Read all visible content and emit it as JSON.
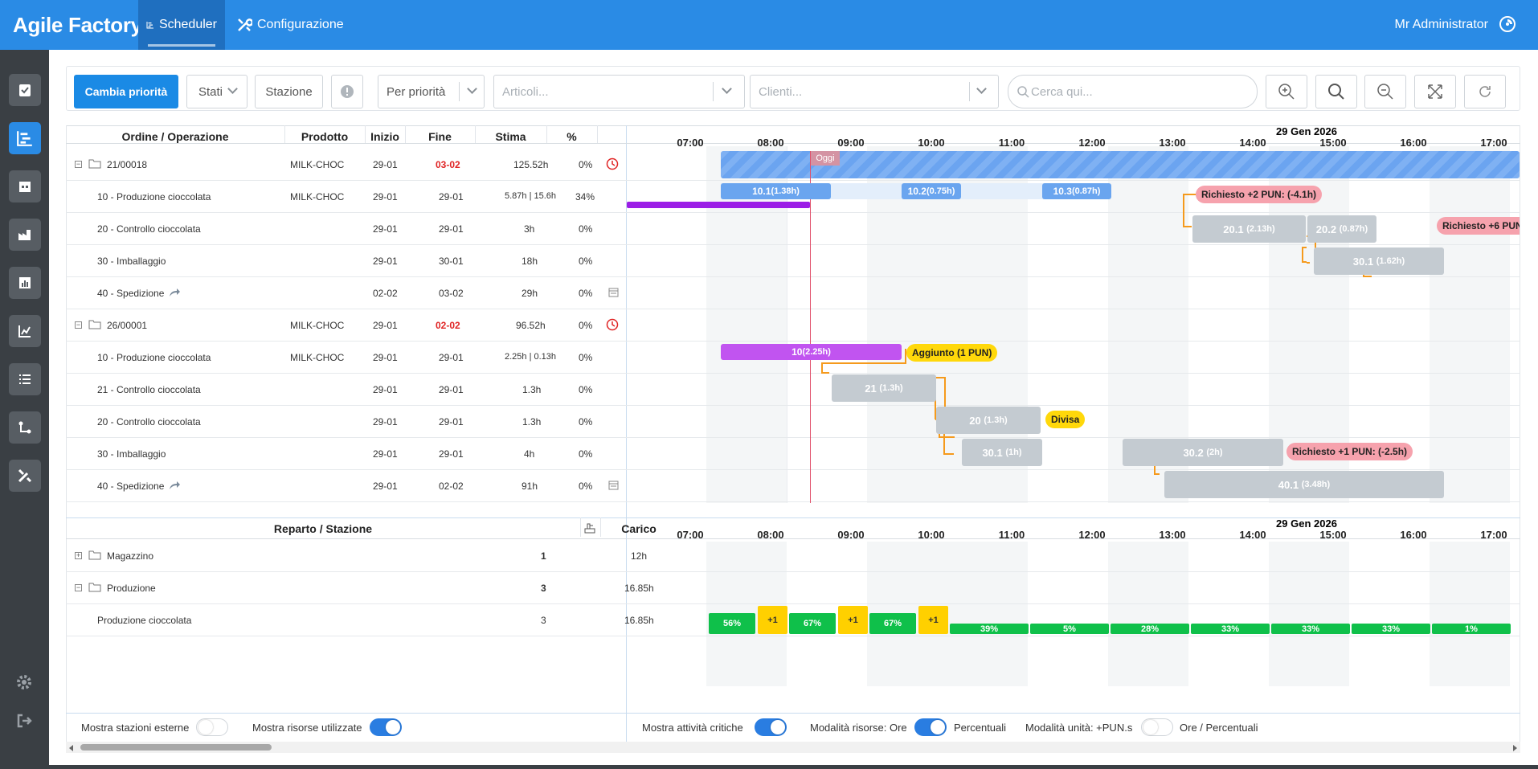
{
  "app": {
    "title": "Agile Factory",
    "user": "Mr Administrator"
  },
  "nav": {
    "scheduler": "Scheduler",
    "config": "Configurazione"
  },
  "toolbar": {
    "cambia_priorita": "Cambia priorità",
    "stati": "Stati",
    "stazione": "Stazione",
    "sort": "Per priorità",
    "articoli_ph": "Articoli...",
    "clienti_ph": "Clienti...",
    "search_ph": "Cerca qui..."
  },
  "orders_table": {
    "headers": {
      "ordine": "Ordine / Operazione",
      "prodotto": "Prodotto",
      "inizio": "Inizio",
      "fine": "Fine",
      "stima": "Stima",
      "pct": "%"
    },
    "rows": [
      {
        "name": "21/00018",
        "prodotto": "MILK-CHOC",
        "inizio": "29-01",
        "fine": "03-02",
        "stima": "125.52h",
        "pct": "0%"
      },
      {
        "name": "10 - Produzione cioccolata",
        "prodotto": "MILK-CHOC",
        "inizio": "29-01",
        "fine": "29-01",
        "stima": "5.87h | 15.6h",
        "pct": "34%"
      },
      {
        "name": "20 - Controllo cioccolata",
        "prodotto": "",
        "inizio": "29-01",
        "fine": "29-01",
        "stima": "3h",
        "pct": "0%"
      },
      {
        "name": "30 - Imballaggio",
        "prodotto": "",
        "inizio": "29-01",
        "fine": "30-01",
        "stima": "18h",
        "pct": "0%"
      },
      {
        "name": "40 - Spedizione",
        "prodotto": "",
        "inizio": "02-02",
        "fine": "03-02",
        "stima": "29h",
        "pct": "0%"
      },
      {
        "name": "26/00001",
        "prodotto": "MILK-CHOC",
        "inizio": "29-01",
        "fine": "02-02",
        "stima": "96.52h",
        "pct": "0%"
      },
      {
        "name": "10 - Produzione cioccolata",
        "prodotto": "MILK-CHOC",
        "inizio": "29-01",
        "fine": "29-01",
        "stima": "2.25h | 0.13h",
        "pct": "0%"
      },
      {
        "name": "21 - Controllo cioccolata",
        "prodotto": "",
        "inizio": "29-01",
        "fine": "29-01",
        "stima": "1.3h",
        "pct": "0%"
      },
      {
        "name": "20 - Controllo cioccolata",
        "prodotto": "",
        "inizio": "29-01",
        "fine": "29-01",
        "stima": "1.3h",
        "pct": "0%"
      },
      {
        "name": "30 - Imballaggio",
        "prodotto": "",
        "inizio": "29-01",
        "fine": "29-01",
        "stima": "4h",
        "pct": "0%"
      },
      {
        "name": "40 - Spedizione",
        "prodotto": "",
        "inizio": "29-01",
        "fine": "02-02",
        "stima": "91h",
        "pct": "0%"
      }
    ]
  },
  "timeline": {
    "date": "29 Gen 2026",
    "hours": [
      "07:00",
      "08:00",
      "09:00",
      "10:00",
      "11:00",
      "12:00",
      "13:00",
      "14:00",
      "15:00",
      "16:00",
      "17:00"
    ],
    "today": "Oggi"
  },
  "gantt": {
    "bar_101": "10.1",
    "bar_101_d": "(1.38h)",
    "bar_102": "10.2",
    "bar_102_d": "(0.75h)",
    "bar_103": "10.3",
    "bar_103_d": "(0.87h)",
    "tag_req2": "Richiesto +2 PUN: (-4.1h)",
    "bar_201": "20.1",
    "bar_201_d": "(2.13h)",
    "bar_202": "20.2",
    "bar_202_d": "(0.87h)",
    "tag_req6": "Richiesto +6 PUN",
    "bar_301a": "30.1",
    "bar_301a_d": "(1.62h)",
    "bar_10b": "10",
    "bar_10b_d": "(2.25h)",
    "tag_aggiunto": "Aggiunto (1 PUN)",
    "bar_21": "21",
    "bar_21_d": "(1.3h)",
    "bar_20": "20",
    "bar_20_d": "(1.3h)",
    "tag_divisa": "Divisa",
    "bar_301b": "30.1",
    "bar_301b_d": "(1h)",
    "bar_302": "30.2",
    "bar_302_d": "(2h)",
    "tag_req1": "Richiesto +1 PUN: (-2.5h)",
    "bar_401": "40.1",
    "bar_401_d": "(3.48h)"
  },
  "resources_table": {
    "headers": {
      "reparto": "Reparto / Stazione",
      "carico": "Carico"
    },
    "rows": [
      {
        "name": "Magazzino",
        "count": "1",
        "carico": "12h"
      },
      {
        "name": "Produzione",
        "count": "3",
        "carico": "16.85h"
      },
      {
        "name": "Produzione cioccolata",
        "count": "3",
        "carico": "16.85h"
      }
    ]
  },
  "load": {
    "l1": "56%",
    "p1": "+1",
    "l2": "67%",
    "p2": "+1",
    "l3": "67%",
    "p3": "+1",
    "l4": "39%",
    "l5": "5%",
    "l6": "28%",
    "l7": "33%",
    "l8": "33%",
    "l9": "33%",
    "l10": "1%"
  },
  "footer": {
    "esterne": "Mostra stazioni esterne",
    "risorse": "Mostra risorse utilizzate",
    "critiche": "Mostra attività critiche",
    "mod_risorse": "Modalità risorse: Ore",
    "percentuali": "Percentuali",
    "mod_unita": "Modalità unità: +PUN.s",
    "ore_perc": "Ore / Percentuali"
  }
}
